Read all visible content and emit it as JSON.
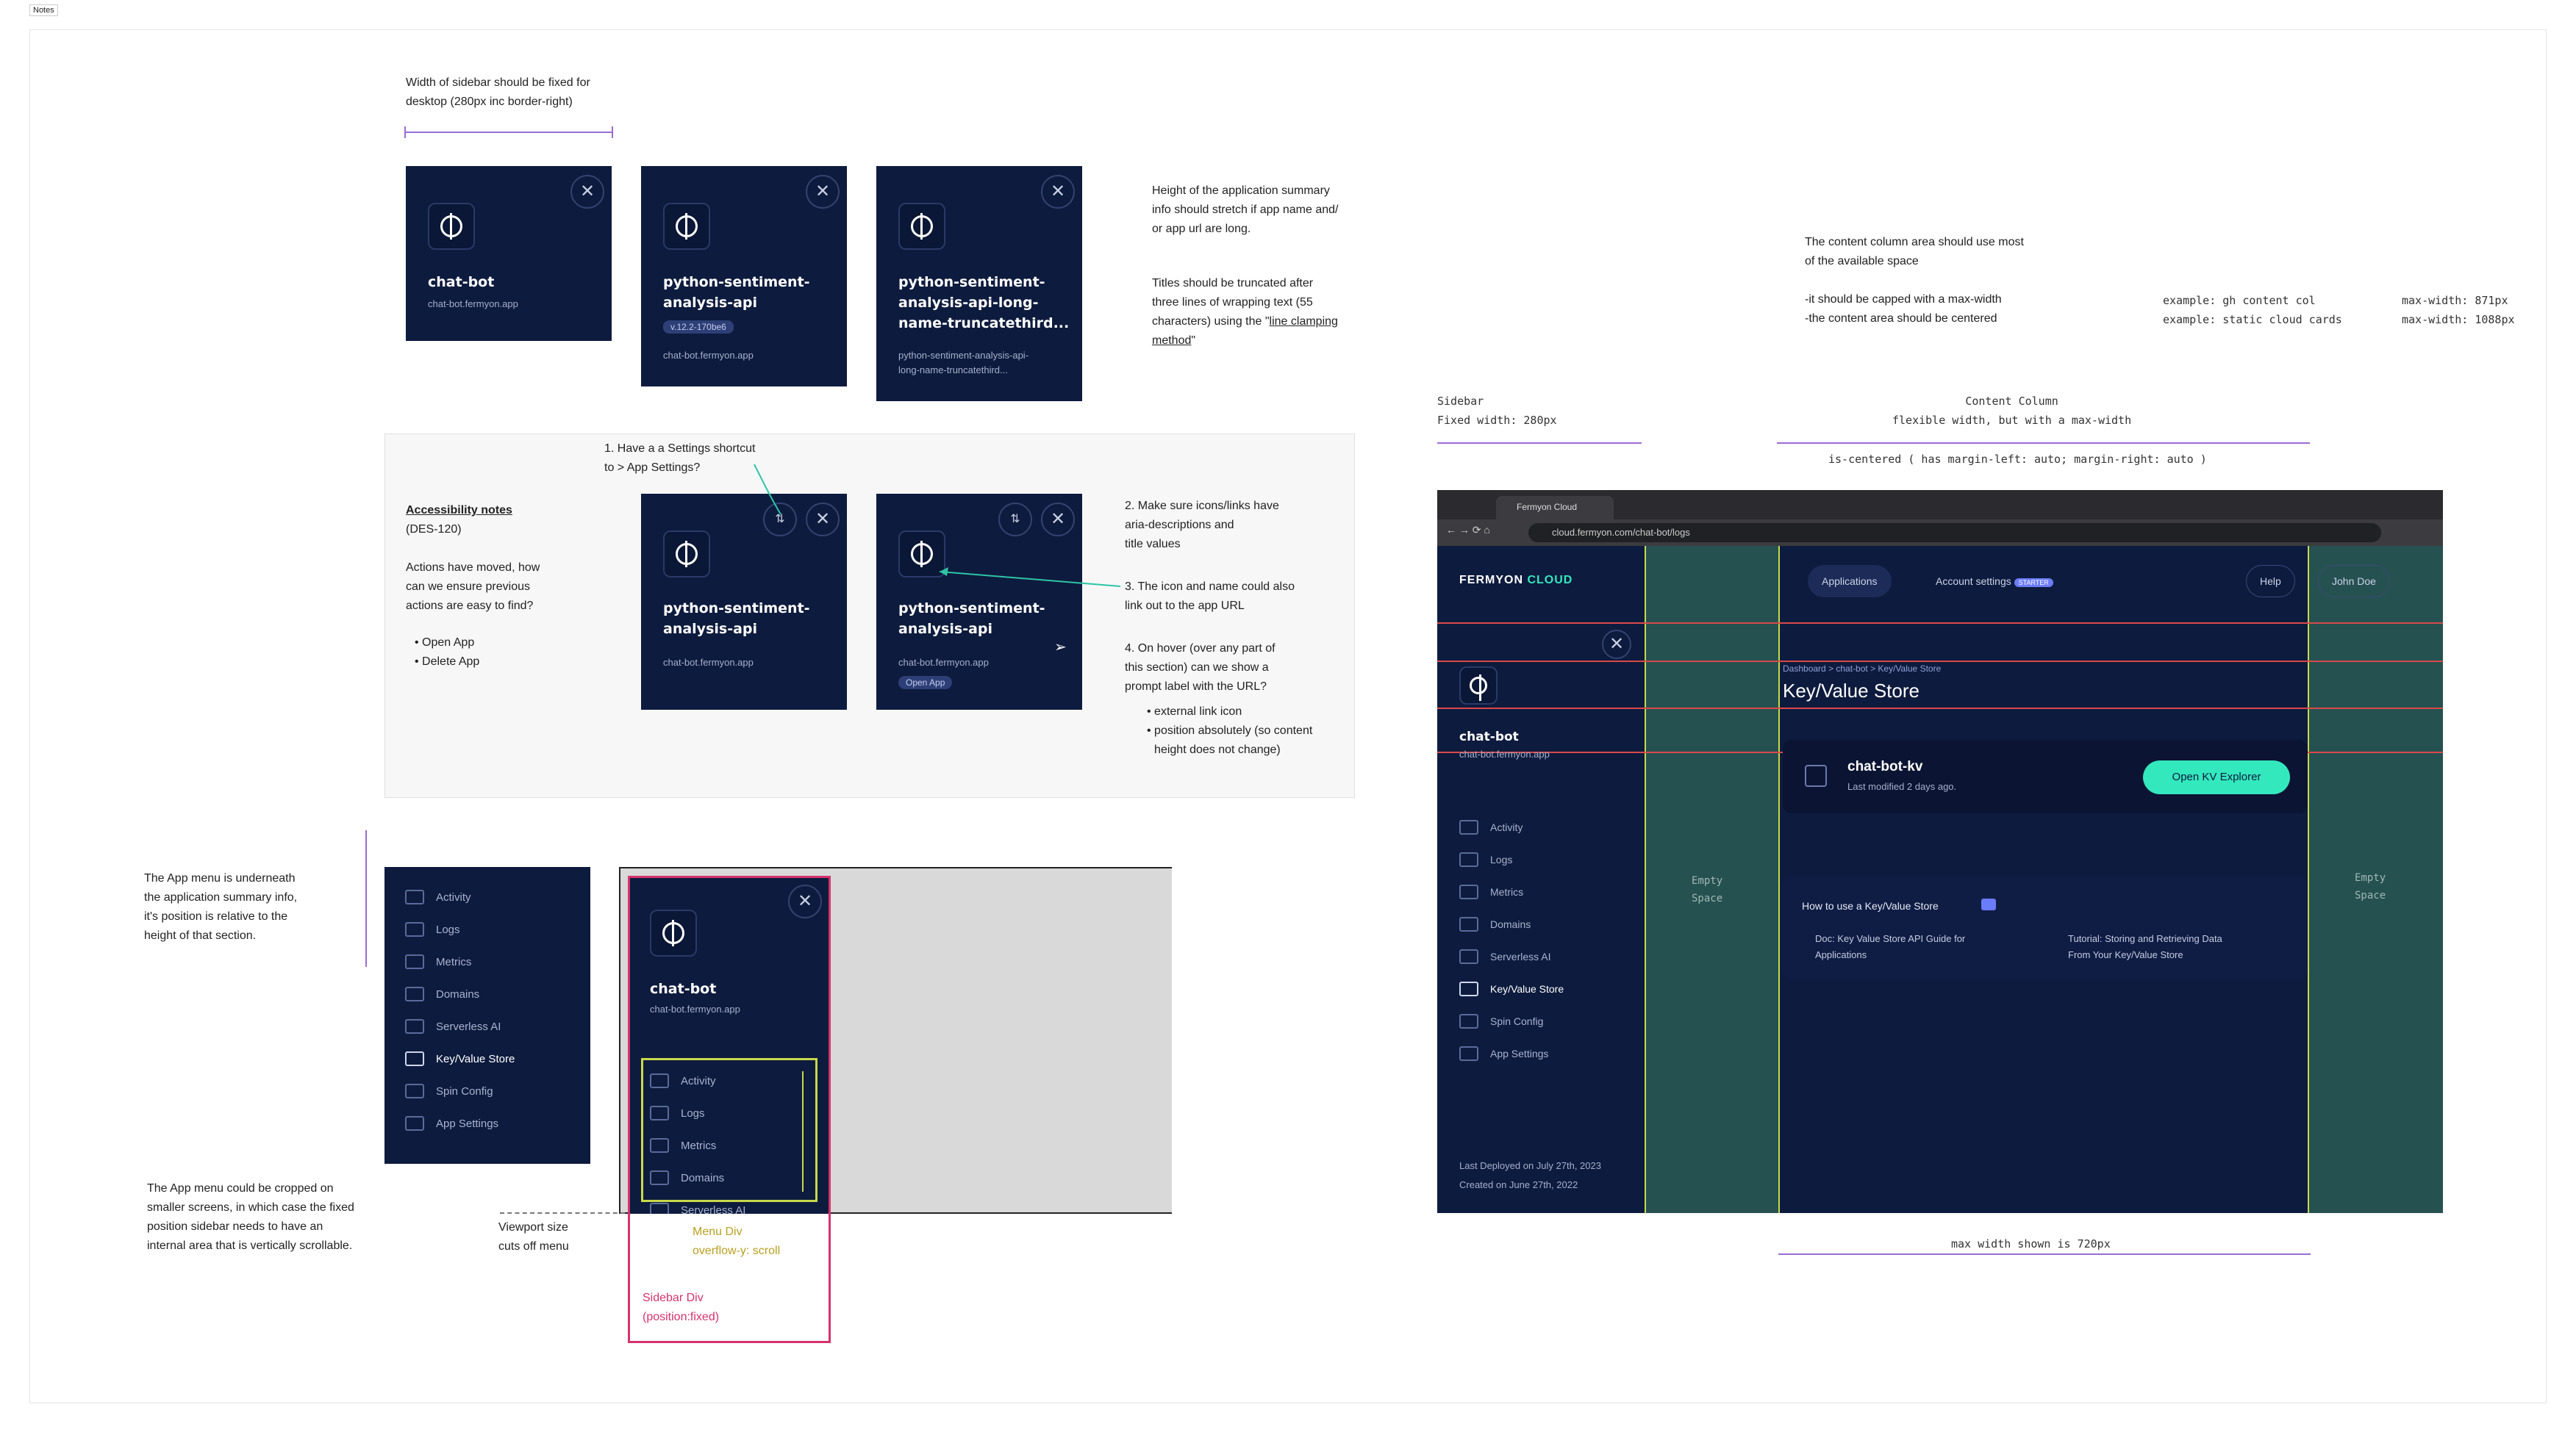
{
  "frame_label": "Notes",
  "notes": {
    "sidebar_width": "Width of sidebar should be fixed for\ndesktop (280px inc border-right)",
    "height_summary": "Height of the application summary\ninfo should stretch if app name and/\nor app url are long.",
    "titles_truncated_pre": "Titles should be truncated after\nthree lines of wrapping text (55\ncharacters) using the \"",
    "titles_truncated_link": "line clamping\nmethod",
    "titles_truncated_post": "\"",
    "content_col_1": "The content column area should use most\nof the available space",
    "content_col_2": "-it should be capped with a max-width\n-the content area should be centered",
    "example_left": "example: gh content col\nexample: static cloud cards",
    "example_right": "max-width: 871px\nmax-width: 1088px",
    "sidebar_label": "Sidebar\nFixed width: 280px",
    "content_col_label": "Content Column\nflexible width, but with a max-width",
    "is_centered": "is-centered  ( has margin-left:  auto; margin-right: auto )",
    "max_width_shown": "max width shown is 720px",
    "settings_shortcut": "1. Have a a Settings shortcut\n   to > App Settings?",
    "accessibility_title": "Accessibility notes",
    "accessibility_body": "(DES-120)\n\nActions have moved, how\ncan we ensure previous\nactions are easy to find?",
    "open_app": "Open App",
    "delete_app": "Delete App",
    "aria_note": "2. Make sure icons/links have\n   aria-descriptions and\n   title values",
    "link_note": "3. The icon and name could also\n   link out to the app URL",
    "hover_note": "4. On hover (over any part of\n   this section) can we show a\n   prompt label with the URL?",
    "hover_bullet_1": "external link icon",
    "hover_bullet_2": "position absolutely (so content\nheight does not change)",
    "app_menu_underneath": "The App menu is underneath\nthe application summary info,\nit's position is relative to the\nheight of that section.",
    "app_menu_cropped": "The App menu could be cropped on\nsmaller screens, in which case the fixed\nposition sidebar needs to have an\ninternal area that is vertically scrollable.",
    "viewport_note": "Viewport size\ncuts off menu",
    "menu_div": "Menu Div\noverflow-y: scroll",
    "sidebar_div": "Sidebar Div\n(position:fixed)",
    "empty_space": "Empty\nSpace"
  },
  "cards": [
    {
      "title": "chat-bot",
      "url": "chat-bot.fermyon.app"
    },
    {
      "title": "python-sentiment-\nanalysis-api",
      "badge": "v.12.2-170be6",
      "url": "chat-bot.fermyon.app"
    },
    {
      "title": "python-sentiment-\nanalysis-api-long-\nname-truncatethird...",
      "url": "python-sentiment-analysis-api-\nlong-name-truncatethird..."
    },
    {
      "title": "python-sentiment-\nanalysis-api",
      "url": "chat-bot.fermyon.app"
    },
    {
      "title": "python-sentiment-\nanalysis-api",
      "url": "chat-bot.fermyon.app",
      "open_app": "Open App"
    }
  ],
  "nav": [
    "Activity",
    "Logs",
    "Metrics",
    "Domains",
    "Serverless AI",
    "Key/Value Store",
    "Spin Config",
    "App Settings"
  ],
  "nav_partial": "Serverless AI",
  "fixed_sidebar": {
    "title": "chat-bot",
    "url": "chat-bot.fermyon.app"
  },
  "browser": {
    "tab_title": "Fermyon Cloud",
    "url": "cloud.fermyon.com/chat-bot/logs",
    "brand_a": "FERMYON",
    "brand_b": "CLOUD",
    "nav_applications": "Applications",
    "nav_account": "Account settings",
    "starter_badge": "STARTER",
    "help": "Help",
    "user": "John Doe",
    "app_title": "chat-bot",
    "app_url": "chat-bot.fermyon.app",
    "breadcrumb": "Dashboard  >  chat-bot  >  Key/Value Store",
    "page_title": "Key/Value Store",
    "kv_name": "chat-bot-kv",
    "kv_modified": "Last modified 2 days ago.",
    "kv_button": "Open KV Explorer",
    "howto_title": "How to use a Key/Value Store",
    "howto_link_1": "Doc: Key Value Store API Guide for\nApplications",
    "howto_link_2": "Tutorial: Storing and Retrieving Data\nFrom Your Key/Value Store",
    "last_deployed": "Last Deployed on July 27th, 2023",
    "created": "Created on June 27th, 2022"
  },
  "colors": {
    "navy": "#0d1b3e",
    "teal": "#34e8bd",
    "purple": "#9b6bd6",
    "red": "#d94a4a",
    "pink": "#d6336c",
    "lime": "#c8d84a",
    "green_arrow": "#2ec4a6"
  }
}
